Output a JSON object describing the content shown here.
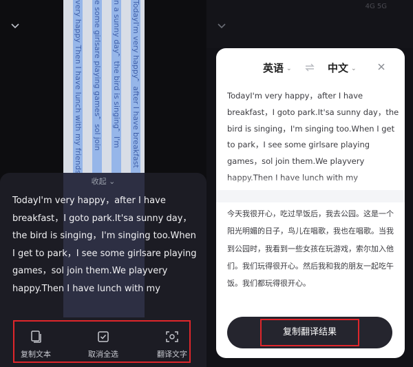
{
  "left": {
    "paper_columns": [
      "TodayI'm very happy，after I have breakfast",
      "n a sunny day，the bird is singing，I'm",
      "e some girlsare playing games，sol join",
      "very happy Then I have lunch with my friends"
    ],
    "collapse_label": "收起",
    "original_text": "TodayI'm very happy，after I have breakfast，I goto park.It'sa sunny day，the bird is singing，I'm singing too.When I get to park，I see some girlsare playing games，sol join them.We playvery happy.Then I have lunch with my",
    "actions": [
      {
        "label": "复制文本",
        "icon": "copy-text-icon"
      },
      {
        "label": "取消全选",
        "icon": "select-all-icon"
      },
      {
        "label": "翻译文字",
        "icon": "translate-scan-icon"
      }
    ]
  },
  "right": {
    "status_text": "4G  5G",
    "source_lang": "英语",
    "target_lang": "中文",
    "source_text": "TodayI'm very happy，after I have breakfast，I goto park.It'sa sunny day，the bird is singing，I'm singing too.When I get to park，I see some girlsare playing games，sol join them.We playvery happy.Then I have lunch with my",
    "translated_text": "今天我很开心，吃过早饭后，我去公园。这是一个阳光明媚的日子，鸟儿在唱歌，我也在唱歌。当我到公园时，我看到一些女孩在玩游戏，索尔加入他们。我们玩得很开心。然后我和我的朋友一起吃午饭。我们都玩得很开心。",
    "copy_button_label": "复制翻译结果"
  },
  "colors": {
    "highlight_red": "#e0262b",
    "sheet_dark": "#1c1c24",
    "button_dark": "#25252e"
  }
}
